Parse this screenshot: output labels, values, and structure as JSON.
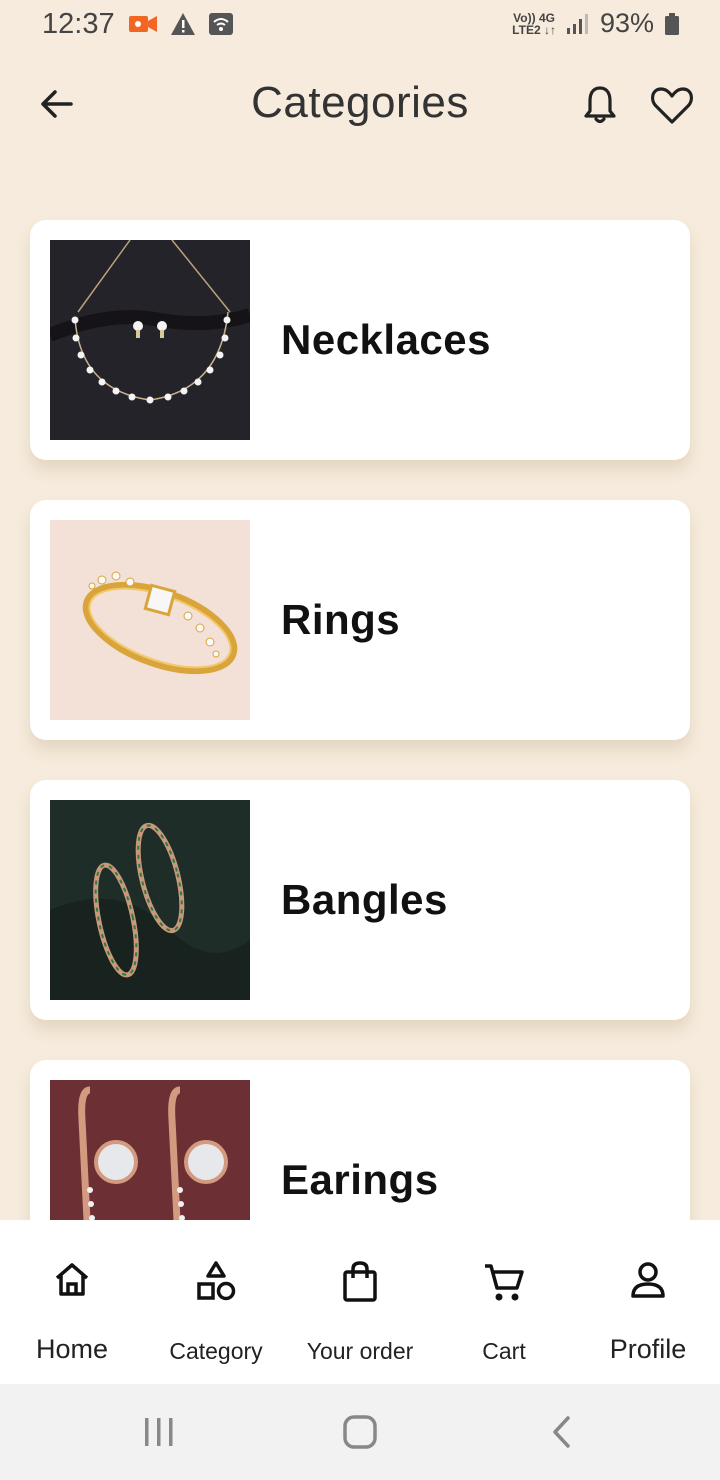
{
  "status_bar": {
    "time": "12:37",
    "network_top": "Vo)) 4G",
    "network_bottom": "LTE2 ↓↑",
    "battery": "93%"
  },
  "header": {
    "title": "Categories"
  },
  "categories": [
    {
      "label": "Necklaces"
    },
    {
      "label": "Rings"
    },
    {
      "label": "Bangles"
    },
    {
      "label": "Earings"
    }
  ],
  "bottom_nav": {
    "items": [
      {
        "label": "Home",
        "icon": "home-icon"
      },
      {
        "label": "Category",
        "icon": "category-shapes-icon"
      },
      {
        "label": "Your order",
        "icon": "shopping-bag-icon"
      },
      {
        "label": "Cart",
        "icon": "cart-icon"
      },
      {
        "label": "Profile",
        "icon": "profile-icon"
      }
    ]
  },
  "colors": {
    "background": "#f6ebdc",
    "card": "#ffffff",
    "record_icon": "#f26522"
  }
}
